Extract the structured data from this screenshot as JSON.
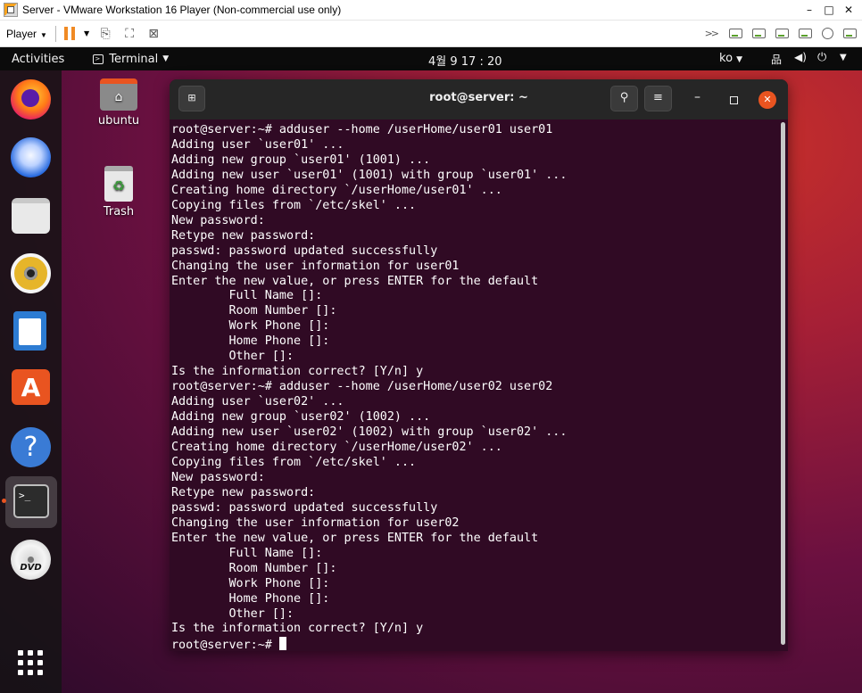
{
  "vmware": {
    "window_title": "Server - VMware Workstation 16 Player (Non-commercial use only)",
    "minimize": "–",
    "maximize": "□",
    "close": "✕",
    "player_menu": "Player"
  },
  "topbar": {
    "activities": "Activities",
    "app_menu": "Terminal",
    "clock": "4월 9  17 : 20",
    "input_method": "ko"
  },
  "desktop": {
    "home_label": "ubuntu",
    "trash_label": "Trash"
  },
  "terminal": {
    "title": "root@server: ~",
    "lines": [
      "root@server:~# adduser --home /userHome/user01 user01",
      "Adding user `user01' ...",
      "Adding new group `user01' (1001) ...",
      "Adding new user `user01' (1001) with group `user01' ...",
      "Creating home directory `/userHome/user01' ...",
      "Copying files from `/etc/skel' ...",
      "New password:",
      "Retype new password:",
      "passwd: password updated successfully",
      "Changing the user information for user01",
      "Enter the new value, or press ENTER for the default",
      "        Full Name []:",
      "        Room Number []:",
      "        Work Phone []:",
      "        Home Phone []:",
      "        Other []:",
      "Is the information correct? [Y/n] y",
      "root@server:~# adduser --home /userHome/user02 user02",
      "Adding user `user02' ...",
      "Adding new group `user02' (1002) ...",
      "Adding new user `user02' (1002) with group `user02' ...",
      "Creating home directory `/userHome/user02' ...",
      "Copying files from `/etc/skel' ...",
      "New password:",
      "Retype new password:",
      "passwd: password updated successfully",
      "Changing the user information for user02",
      "Enter the new value, or press ENTER for the default",
      "        Full Name []:",
      "        Room Number []:",
      "        Work Phone []:",
      "        Home Phone []:",
      "        Other []:",
      "Is the information correct? [Y/n] y"
    ],
    "prompt": "root@server:~# "
  },
  "dock": {
    "icons": [
      "firefox-icon",
      "thunderbird-icon",
      "files-icon",
      "rhythmbox-icon",
      "writer-icon",
      "software-icon",
      "help-icon",
      "terminal-icon",
      "dvd-icon",
      "show-apps-icon"
    ]
  },
  "colors": {
    "terminal_bg": "#300a24",
    "ubuntu_orange": "#e95420",
    "vmware_pause": "#f08a24"
  }
}
